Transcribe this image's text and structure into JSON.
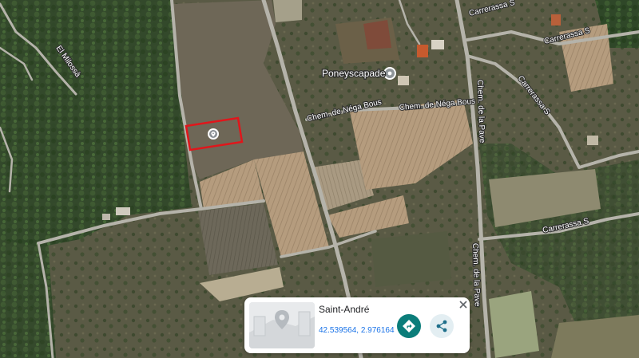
{
  "map": {
    "road_labels": {
      "el_milossa": "El Milossà",
      "carrerassa_top": "Carrerassa S",
      "carrerassa_top_right": "Carrerassa S",
      "carrerassa_diag": "Carrerassa S",
      "carrerassa_bottom": "Carrerassa S",
      "nega_bous_left": "Chem. de Néga Bous",
      "nega_bous_right": "Chem. de Néga Bous",
      "la_pave_top": "Chem. de la Pave",
      "la_pave_bottom": "Chem. de la Pave"
    },
    "place_label": "Poneyscapade",
    "selection_color": "#e0161b"
  },
  "card": {
    "title": "Saint-André",
    "coordinates": "42.539564, 2.976164",
    "directions_icon": "directions-icon",
    "share_icon": "share-icon",
    "close_icon": "close-icon"
  }
}
